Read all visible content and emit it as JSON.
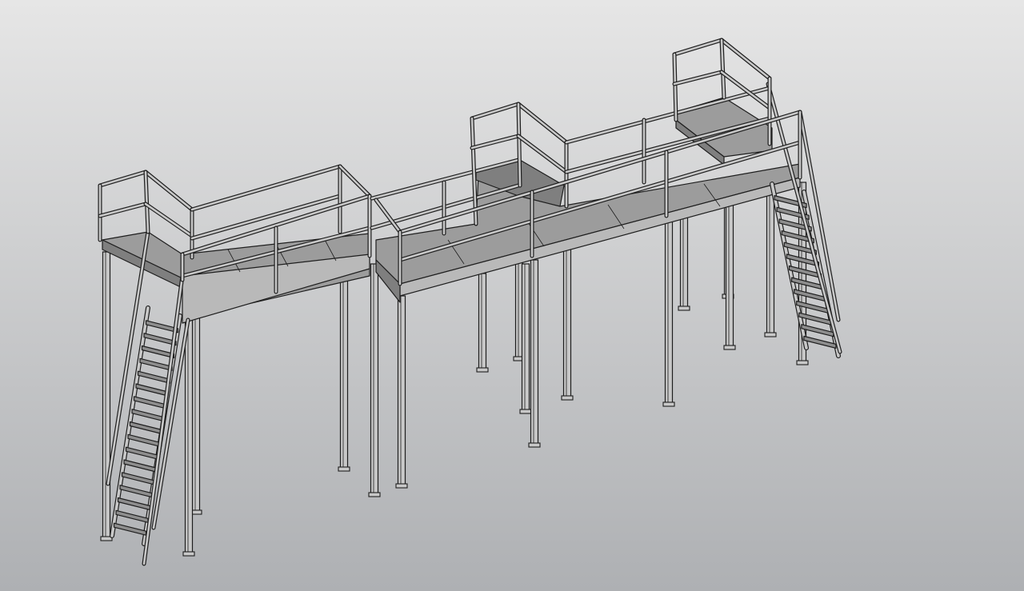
{
  "viewport": {
    "background_top": "#e6e6e6",
    "background_bottom": "#aeb0b3"
  },
  "model": {
    "line_color": "#1e1e1e",
    "steel_color": "#c8c8c8",
    "deck_color": "#9c9c9c",
    "deck_dark_color": "#7f7f7f",
    "beam_color": "#b9b9b9",
    "tread_color": "#8d8d8d"
  }
}
